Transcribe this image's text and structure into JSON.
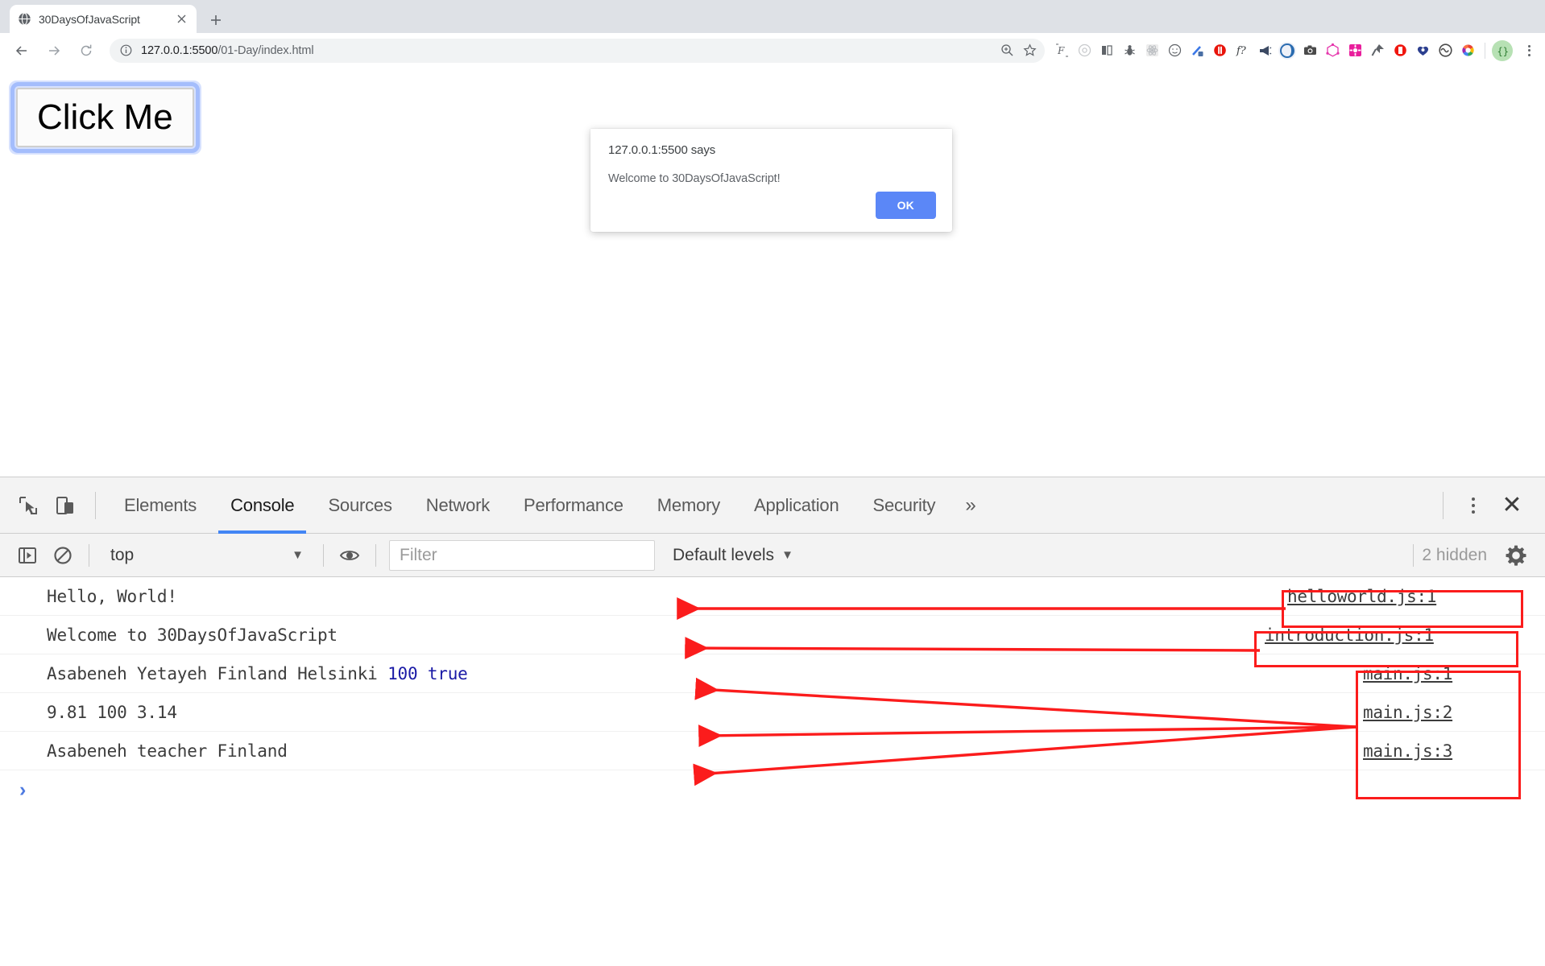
{
  "browser": {
    "tab": {
      "title": "30DaysOfJavaScript",
      "favicon_icon": "globe-icon",
      "close_icon": "close-icon"
    },
    "new_tab_icon": "plus-icon",
    "nav": {
      "back_icon": "arrow-left-icon",
      "forward_icon": "arrow-right-icon",
      "reload_icon": "reload-icon"
    },
    "omnibox": {
      "info_icon": "info-circle-icon",
      "url_host": "127.0.0.1:5500",
      "url_path": "/01-Day/index.html",
      "zoom_icon": "zoom-in-icon",
      "bookmark_icon": "star-icon"
    },
    "extensions": [
      "script-icon",
      "target-icon",
      "columns-icon",
      "bug-icon",
      "react-icon",
      "smiley-icon",
      "eyedropper-icon",
      "adblock-icon",
      "function-icon",
      "megaphone-icon",
      "pocket-icon",
      "camera-icon",
      "graphql-icon",
      "settings-pink-icon",
      "pushpin-icon",
      "redbook-icon",
      "heart-key-icon",
      "moon-icon",
      "wave-icon",
      "color-wheel-icon"
    ],
    "brackets_icon": "curly-braces-icon",
    "avatar_glyph": "●",
    "menu_icon": "kebab-menu-icon"
  },
  "page": {
    "click_button_label": "Click Me"
  },
  "alert": {
    "origin": "127.0.0.1:5500 says",
    "message": "Welcome to 30DaysOfJavaScript!",
    "ok_label": "OK",
    "ok_color": "#5b87f7"
  },
  "devtools": {
    "inspect_icon": "cursor-select-icon",
    "device_toolbar_icon": "device-toggle-icon",
    "tabs": [
      {
        "label": "Elements",
        "active": false
      },
      {
        "label": "Console",
        "active": true
      },
      {
        "label": "Sources",
        "active": false
      },
      {
        "label": "Network",
        "active": false
      },
      {
        "label": "Performance",
        "active": false
      },
      {
        "label": "Memory",
        "active": false
      },
      {
        "label": "Application",
        "active": false
      },
      {
        "label": "Security",
        "active": false
      }
    ],
    "more_tabs_glyph": "»",
    "kebab_icon": "kebab-menu-icon",
    "close_glyph": "✕",
    "active_tab_color": "#4285f4",
    "toolbar": {
      "sidebar_icon": "sidebar-toggle-icon",
      "clear_icon": "clear-console-icon",
      "context_value": "top",
      "context_caret": "▼",
      "eye_icon": "live-expression-icon",
      "filter_placeholder": "Filter",
      "levels_label": "Default levels",
      "levels_caret": "▼",
      "hidden_count_label": "2 hidden",
      "settings_icon": "gear-icon"
    },
    "console_rows": [
      {
        "segments": [
          {
            "text": "Hello, World!",
            "kind": "text"
          }
        ],
        "source": "helloworld.js:1"
      },
      {
        "segments": [
          {
            "text": "Welcome to 30DaysOfJavaScript",
            "kind": "text"
          }
        ],
        "source": "introduction.js:1"
      },
      {
        "segments": [
          {
            "text": "Asabeneh Yetayeh Finland Helsinki ",
            "kind": "text"
          },
          {
            "text": "100 true",
            "kind": "num"
          }
        ],
        "source": "main.js:1"
      },
      {
        "segments": [
          {
            "text": "9.81 100 3.14",
            "kind": "num"
          }
        ],
        "source": "main.js:2"
      },
      {
        "segments": [
          {
            "text": "Asabeneh teacher Finland",
            "kind": "text"
          }
        ],
        "source": "main.js:3"
      }
    ],
    "prompt_glyph": "›"
  },
  "annotations": {
    "highlight_color": "#fb1c1c",
    "boxes": [
      {
        "label": "helloworld-source-box"
      },
      {
        "label": "introduction-source-box"
      },
      {
        "label": "mainjs-source-group-box"
      }
    ]
  }
}
